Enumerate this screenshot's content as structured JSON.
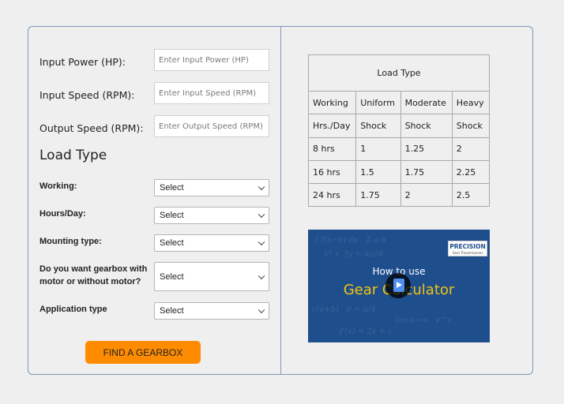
{
  "form": {
    "input_power": {
      "label": "Input Power (HP):",
      "placeholder": "Enter Input Power (HP)"
    },
    "input_speed": {
      "label": "Input Speed (RPM):",
      "placeholder": "Enter Input Speed (RPM)"
    },
    "output_speed": {
      "label": "Output Speed (RPM):",
      "placeholder": "Enter Output Speed (RPM)"
    },
    "section_title": "Load Type",
    "selects": [
      {
        "label": "Working:",
        "value": "Select"
      },
      {
        "label": "Hours/Day:",
        "value": "Select"
      },
      {
        "label": "Mounting type:",
        "value": "Select"
      },
      {
        "label": "Do you want gearbox with motor or without motor?",
        "value": "Select"
      },
      {
        "label": "Application type",
        "value": "Select"
      }
    ],
    "submit_label": "FIND A GEARBOX"
  },
  "load_table": {
    "title": "Load Type",
    "header_row1": [
      "Working",
      "Uniform",
      "Moderate",
      "Heavy"
    ],
    "header_row2": [
      "Hrs./Day",
      "Shock",
      "Shock",
      "Shock"
    ],
    "rows": [
      [
        "8 hrs",
        "1",
        "1.25",
        "2"
      ],
      [
        "16 hrs",
        "1.5",
        "1.75",
        "2.25"
      ],
      [
        "24 hrs",
        "1.75",
        "2",
        "2.5"
      ]
    ]
  },
  "video": {
    "line1": "How to use",
    "line2": "Gear Calculator",
    "logo_text": "PRECISION",
    "logo_sub": "Gear Transmissions",
    "colors": {
      "background": "#1f4e8c",
      "accent": "#f1c40f"
    }
  },
  "colors": {
    "button": "#ff8c00",
    "panel_border": "#7f97b8"
  }
}
